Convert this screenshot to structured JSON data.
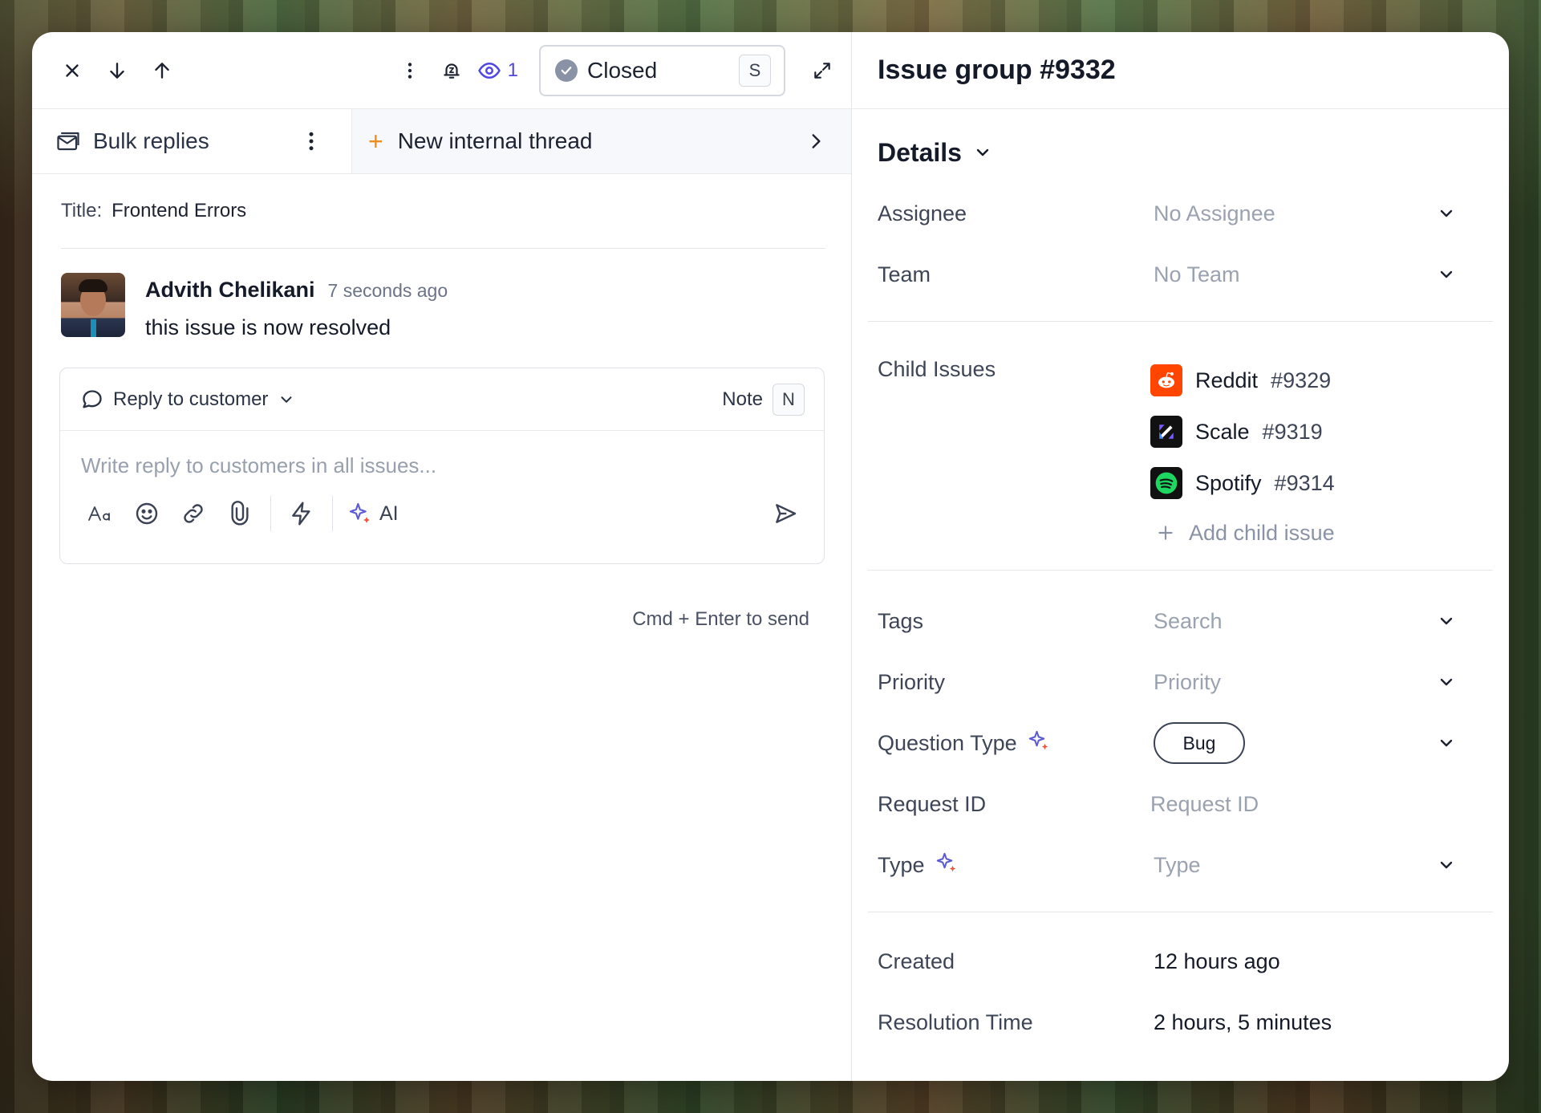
{
  "toolbar": {
    "watch_count": "1",
    "status_label": "Closed",
    "status_shortcut": "S"
  },
  "thread": {
    "bulk_label": "Bulk replies",
    "new_thread_label": "New internal thread"
  },
  "issue": {
    "title_label": "Title:",
    "title_value": "Frontend Errors"
  },
  "message": {
    "author": "Advith Chelikani",
    "time": "7 seconds ago",
    "text": "this issue is now resolved"
  },
  "composer": {
    "mode_label": "Reply to customer",
    "note_label": "Note",
    "note_shortcut": "N",
    "placeholder": "Write reply to customers in all issues...",
    "ai_label": "AI",
    "hint": "Cmd + Enter to send"
  },
  "panel": {
    "title": "Issue group #9332",
    "details_label": "Details",
    "assignee_label": "Assignee",
    "assignee_value": "No Assignee",
    "team_label": "Team",
    "team_value": "No Team",
    "child_issues_label": "Child Issues",
    "child_issues": [
      {
        "name": "Reddit",
        "number": "#9329",
        "color": "#ff4500"
      },
      {
        "name": "Scale",
        "number": "#9319",
        "color": "#111111"
      },
      {
        "name": "Spotify",
        "number": "#9314",
        "color": "#111111"
      }
    ],
    "add_child_label": "Add child issue",
    "tags_label": "Tags",
    "tags_value": "Search",
    "priority_label": "Priority",
    "priority_value": "Priority",
    "question_type_label": "Question Type",
    "question_type_value": "Bug",
    "request_id_label": "Request ID",
    "request_id_value": "Request ID",
    "type_label": "Type",
    "type_value": "Type",
    "created_label": "Created",
    "created_value": "12 hours ago",
    "resolution_label": "Resolution Time",
    "resolution_value": "2 hours, 5 minutes"
  },
  "colors": {
    "accent": "#4f46e5",
    "plus_orange": "#f08c1a",
    "spotify_green": "#1ed760"
  }
}
